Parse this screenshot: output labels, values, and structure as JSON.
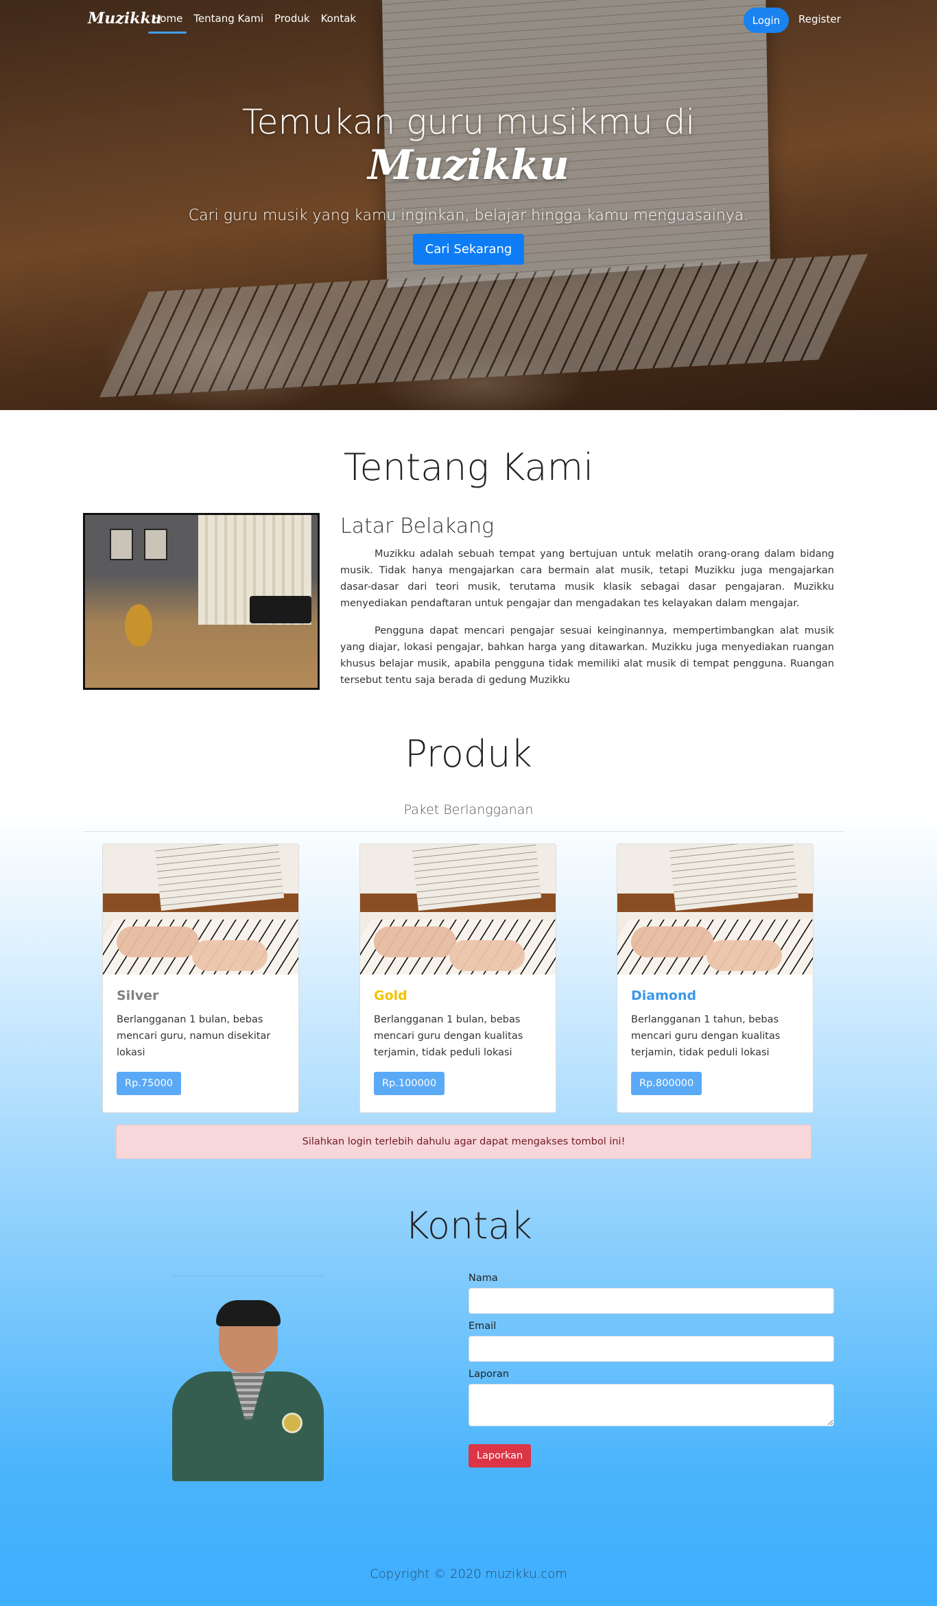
{
  "nav": {
    "brand": "Muzikku",
    "links": [
      "Home",
      "Tentang Kami",
      "Produk",
      "Kontak"
    ],
    "active": "Home",
    "login_label": "Login",
    "register_label": "Register"
  },
  "hero": {
    "title": "Temukan guru musikmu di",
    "brand": "Muzikku",
    "subtitle": "Cari guru musik yang kamu inginkan, belajar hingga kamu menguasainya.",
    "cta_label": "Cari Sekarang"
  },
  "about": {
    "title": "Tentang Kami",
    "subtitle": "Latar Belakang",
    "paragraphs": [
      "Muzikku adalah sebuah tempat yang bertujuan untuk melatih orang-orang dalam bidang musik. Tidak hanya mengajarkan cara bermain alat musik, tetapi Muzikku juga mengajarkan dasar-dasar dari teori musik, terutama musik klasik sebagai dasar pengajaran. Muzikku menyediakan pendaftaran untuk pengajar dan mengadakan tes kelayakan dalam mengajar.",
      "Pengguna dapat mencari pengajar sesuai keinginannya, mempertimbangkan alat musik yang diajar, lokasi pengajar, bahkan harga yang ditawarkan. Muzikku juga menyediakan ruangan khusus belajar musik, apabila pengguna tidak memiliki alat musik di tempat pengguna. Ruangan tersebut tentu saja berada di gedung Muzikku"
    ]
  },
  "products": {
    "title": "Produk",
    "subtitle": "Paket Berlangganan",
    "cards": [
      {
        "name": "Silver",
        "color": "#808080",
        "desc": "Berlangganan 1 bulan, bebas mencari guru, namun disekitar lokasi",
        "price": "Rp.75000"
      },
      {
        "name": "Gold",
        "color": "#f2c200",
        "desc": "Berlangganan 1 bulan, bebas mencari guru dengan kualitas terjamin, tidak peduli lokasi",
        "price": "Rp.100000"
      },
      {
        "name": "Diamond",
        "color": "#3c97e8",
        "desc": "Berlangganan 1 tahun, bebas mencari guru dengan kualitas terjamin, tidak peduli lokasi",
        "price": "Rp.800000"
      }
    ],
    "alert": "Silahkan login terlebih dahulu agar dapat mengakses tombol ini!"
  },
  "contact": {
    "title": "Kontak",
    "fields": {
      "name_label": "Nama",
      "email_label": "Email",
      "report_label": "Laporan"
    },
    "submit_label": "Laporkan"
  },
  "footer": {
    "copyright": "Copyright © 2020 muzikku.com"
  },
  "colors": {
    "primary": "#0d7cf5",
    "danger": "#dc3545",
    "alert_bg": "#f7d7da"
  }
}
